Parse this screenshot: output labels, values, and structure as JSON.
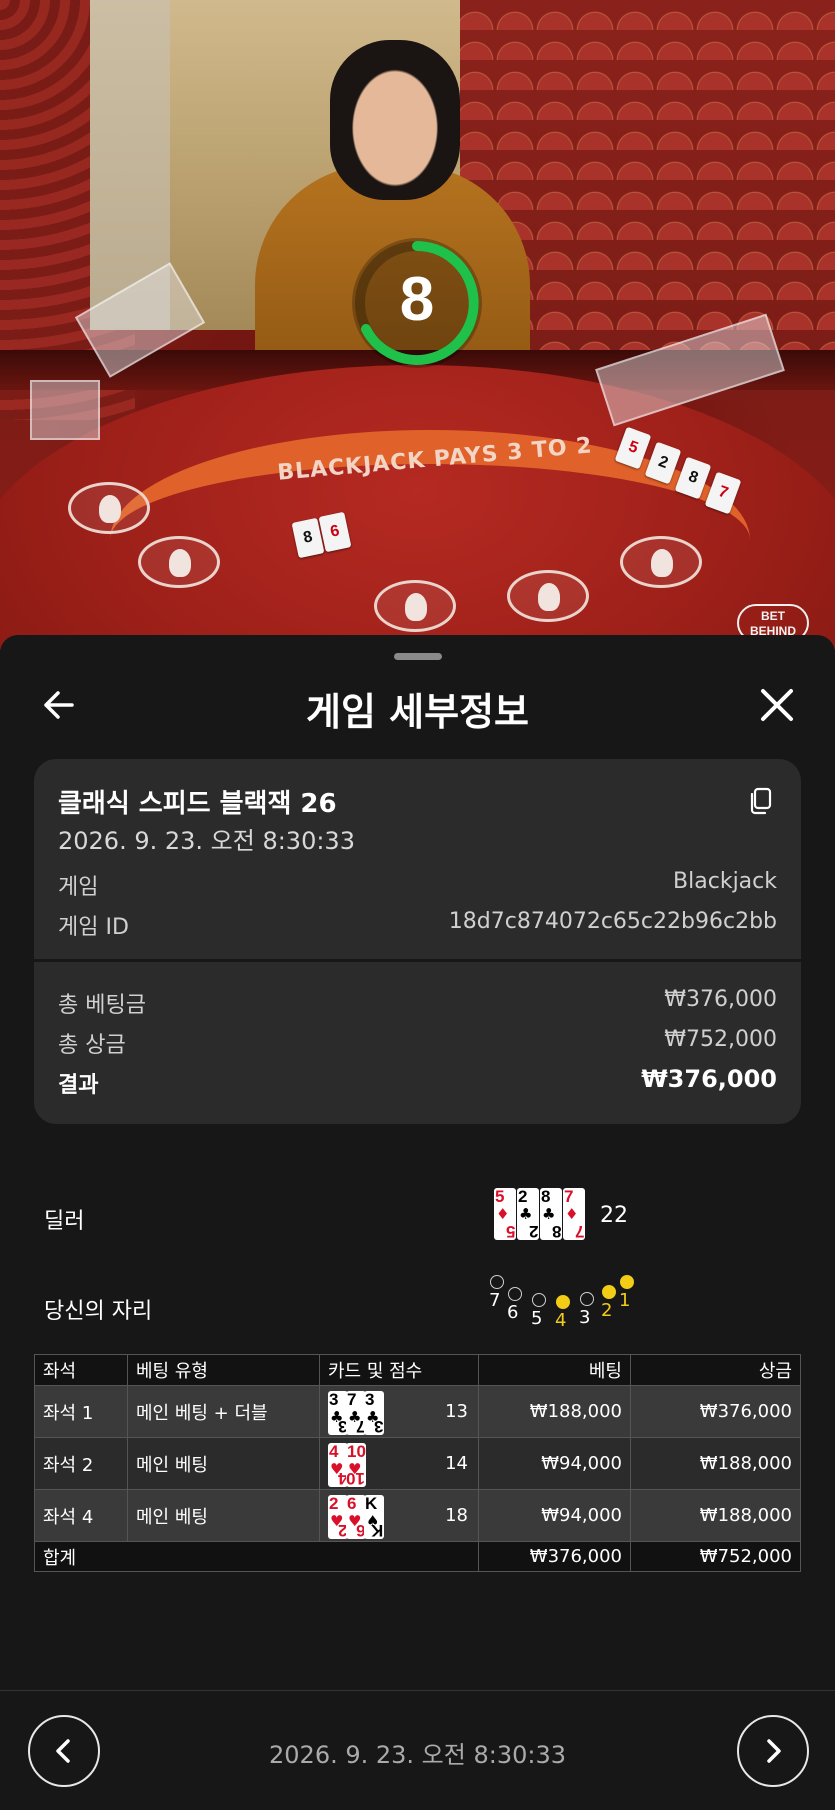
{
  "video": {
    "timer": "8",
    "table_text": "BLACKJACK PAYS 3 TO 2",
    "bet_behind": "BET BEHIND"
  },
  "sheet": {
    "title": "게임 세부정보",
    "back_icon": "arrow-left-icon",
    "close_icon": "close-icon"
  },
  "info": {
    "table_name": "클래식 스피드 블랙잭 26",
    "datetime": "2026. 9. 23. 오전 8:30:33",
    "game_label": "게임",
    "game_value": "Blackjack",
    "game_id_label": "게임 ID",
    "game_id_value": "18d7c874072c65c22b96c2bb",
    "copy_icon": "copy-icon"
  },
  "money": {
    "total_bet_label": "총 베팅금",
    "total_bet_value": "₩376,000",
    "total_win_label": "총 상금",
    "total_win_value": "₩752,000",
    "result_label": "결과",
    "result_value": "₩376,000"
  },
  "dealer": {
    "label": "딜러",
    "cards": [
      {
        "rank": "5",
        "suit": "♦",
        "color": "red"
      },
      {
        "rank": "2",
        "suit": "♣",
        "color": "black"
      },
      {
        "rank": "8",
        "suit": "♣",
        "color": "black"
      },
      {
        "rank": "7",
        "suit": "♦",
        "color": "red"
      }
    ],
    "score": "22"
  },
  "seats": {
    "label": "당신의 자리",
    "positions": [
      {
        "num": "7",
        "active": false
      },
      {
        "num": "6",
        "active": false
      },
      {
        "num": "5",
        "active": false
      },
      {
        "num": "4",
        "active": true
      },
      {
        "num": "3",
        "active": false
      },
      {
        "num": "2",
        "active": true
      },
      {
        "num": "1",
        "active": true
      }
    ]
  },
  "table": {
    "headers": [
      "좌석",
      "베팅 유형",
      "카드 및 점수",
      "베팅",
      "상금"
    ],
    "rows": [
      {
        "seat": "좌석 1",
        "type": "메인 베팅 + 더블",
        "cards": [
          {
            "rank": "3",
            "suit": "♣",
            "color": "black"
          },
          {
            "rank": "7",
            "suit": "♣",
            "color": "black"
          },
          {
            "rank": "3",
            "suit": "♣",
            "color": "black"
          }
        ],
        "score": "13",
        "bet": "₩188,000",
        "win": "₩376,000"
      },
      {
        "seat": "좌석 2",
        "type": "메인 베팅",
        "cards": [
          {
            "rank": "4",
            "suit": "♥",
            "color": "red"
          },
          {
            "rank": "10",
            "suit": "♥",
            "color": "red"
          }
        ],
        "score": "14",
        "bet": "₩94,000",
        "win": "₩188,000"
      },
      {
        "seat": "좌석 4",
        "type": "메인 베팅",
        "cards": [
          {
            "rank": "2",
            "suit": "♥",
            "color": "red"
          },
          {
            "rank": "6",
            "suit": "♥",
            "color": "red"
          },
          {
            "rank": "K",
            "suit": "♠",
            "color": "black"
          }
        ],
        "score": "18",
        "bet": "₩94,000",
        "win": "₩188,000"
      }
    ],
    "total_label": "합계",
    "total_bet": "₩376,000",
    "total_win": "₩752,000"
  },
  "footer": {
    "datetime": "2026. 9. 23. 오전 8:30:33",
    "prev_icon": "chevron-left-icon",
    "next_icon": "chevron-right-icon"
  }
}
